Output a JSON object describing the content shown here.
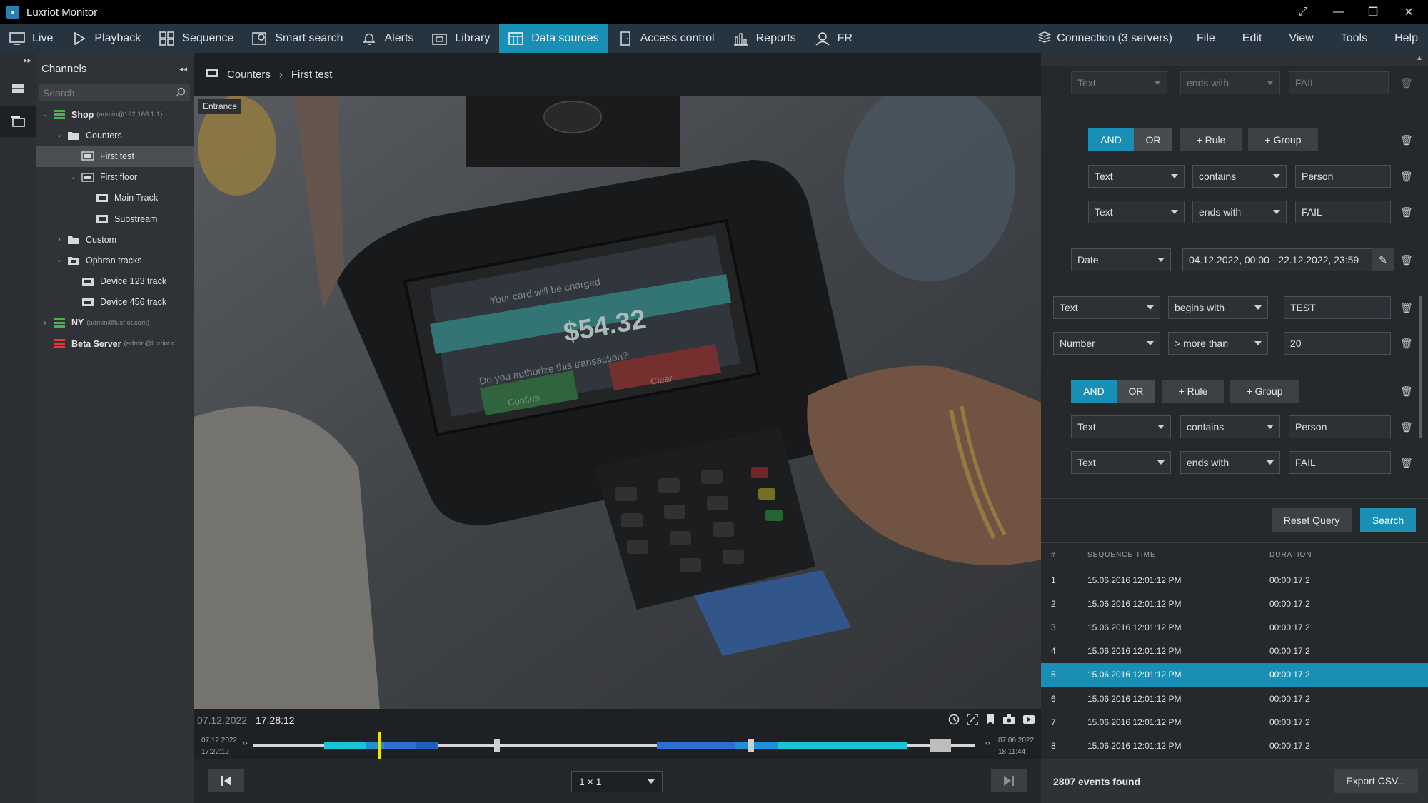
{
  "window": {
    "title": "Luxriot Monitor",
    "controls": [
      "expand-icon",
      "minimize-icon",
      "restore-icon",
      "close-icon"
    ]
  },
  "menu": {
    "items": [
      {
        "label": "Live",
        "icon": "monitor-icon"
      },
      {
        "label": "Playback",
        "icon": "play-icon"
      },
      {
        "label": "Sequence",
        "icon": "grid-icon"
      },
      {
        "label": "Smart search",
        "icon": "smart-search-icon"
      },
      {
        "label": "Alerts",
        "icon": "bell-icon"
      },
      {
        "label": "Library",
        "icon": "library-icon"
      },
      {
        "label": "Data sources",
        "icon": "data-sources-icon"
      },
      {
        "label": "Access control",
        "icon": "door-icon"
      },
      {
        "label": "Reports",
        "icon": "reports-icon"
      },
      {
        "label": "FR",
        "icon": "face-icon"
      }
    ],
    "active": "Data sources",
    "right": {
      "connection": "Connection (3 servers)",
      "file": "File",
      "edit": "Edit",
      "view": "View",
      "tools": "Tools",
      "help": "Help"
    }
  },
  "channels": {
    "header": "Channels",
    "search_placeholder": "Search",
    "tree": [
      {
        "label": "Shop",
        "sub": "(admin@192.168.1.1)",
        "level": 0,
        "arrow": "v",
        "icon": "server-green"
      },
      {
        "label": "Counters",
        "level": 1,
        "arrow": "v",
        "icon": "folder"
      },
      {
        "label": "First test",
        "level": 2,
        "arrow": "",
        "icon": "sequence",
        "selected": true
      },
      {
        "label": "First floor",
        "level": 2,
        "arrow": "v",
        "icon": "sequence"
      },
      {
        "label": "Main Track",
        "level": 3,
        "arrow": "",
        "icon": "camera"
      },
      {
        "label": "Substream",
        "level": 3,
        "arrow": "",
        "icon": "camera"
      },
      {
        "label": "Custom",
        "level": 1,
        "arrow": ">",
        "icon": "folder"
      },
      {
        "label": "Ophran tracks",
        "level": 1,
        "arrow": "v",
        "icon": "folder-tracks"
      },
      {
        "label": "Device 123 track",
        "level": 2,
        "arrow": "",
        "icon": "camera"
      },
      {
        "label": "Device 456 track",
        "level": 2,
        "arrow": "",
        "icon": "camera"
      },
      {
        "label": "NY",
        "sub": "(admin@luxriot.com)",
        "level": 0,
        "arrow": ">",
        "icon": "server-green"
      },
      {
        "label": "Beta Server",
        "sub": "(admin@luxriot.c...",
        "level": 0,
        "arrow": "",
        "icon": "server-red"
      }
    ]
  },
  "breadcrumb": {
    "root": "Counters",
    "current": "First test"
  },
  "video": {
    "overlay_label": "Entrance",
    "screen_text_top": "Your card will be charged",
    "screen_amount": "$54.32",
    "screen_question": "Do you authorize this transaction?",
    "confirm": "Confirm",
    "clear": "Clear"
  },
  "playback": {
    "date": "07.12.2022",
    "time": "17:28:12",
    "range_start_date": "07.12.2022",
    "range_start_time": "17:22:12",
    "range_end_date": "07.06.2022",
    "range_end_time": "18:11:44",
    "layout": "1 × 1"
  },
  "query": {
    "rows": [
      {
        "field": "Text",
        "op": "ends with",
        "value": "FAIL",
        "dim": true
      },
      {
        "field": "Text",
        "op": "contains",
        "value": "Person"
      },
      {
        "field": "Text",
        "op": "ends with",
        "value": "FAIL"
      },
      {
        "field": "Date",
        "value": "04.12.2022, 00:00 - 22.12.2022, 23:59"
      },
      {
        "field": "Text",
        "op": "begins with",
        "value": "TEST"
      },
      {
        "field": "Number",
        "op": "> more than",
        "value": "20"
      },
      {
        "field": "Text",
        "op": "contains",
        "value": "Person"
      },
      {
        "field": "Text",
        "op": "ends with",
        "value": "FAIL"
      }
    ],
    "and_label": "AND",
    "or_label": "OR",
    "rule_label": "+  Rule",
    "group_label": "+  Group",
    "reset": "Reset Query",
    "search": "Search"
  },
  "results": {
    "columns": [
      "#",
      "SEQUENCE TIME",
      "DURATION"
    ],
    "rows": [
      [
        "1",
        "15.06.2016 12:01:12 PM",
        "00:00:17.2"
      ],
      [
        "2",
        "15.06.2016 12:01:12 PM",
        "00:00:17.2"
      ],
      [
        "3",
        "15.06.2016 12:01:12 PM",
        "00:00:17.2"
      ],
      [
        "4",
        "15.06.2016 12:01:12 PM",
        "00:00:17.2"
      ],
      [
        "5",
        "15.06.2016 12:01:12 PM",
        "00:00:17.2"
      ],
      [
        "6",
        "15.06.2016 12:01:12 PM",
        "00:00:17.2"
      ],
      [
        "7",
        "15.06.2016 12:01:12 PM",
        "00:00:17.2"
      ],
      [
        "8",
        "15.06.2016 12:01:12 PM",
        "00:00:17.2"
      ]
    ],
    "highlighted": "5",
    "count": "2807 events found",
    "export": "Export CSV..."
  },
  "colors": {
    "accent": "#1a8fb5",
    "menubar": "#26343f",
    "panel": "#2f3337",
    "timeline_cyan": "#19c4d6",
    "timeline_blue": "#2a6fd1",
    "playhead": "#e8e01a"
  }
}
